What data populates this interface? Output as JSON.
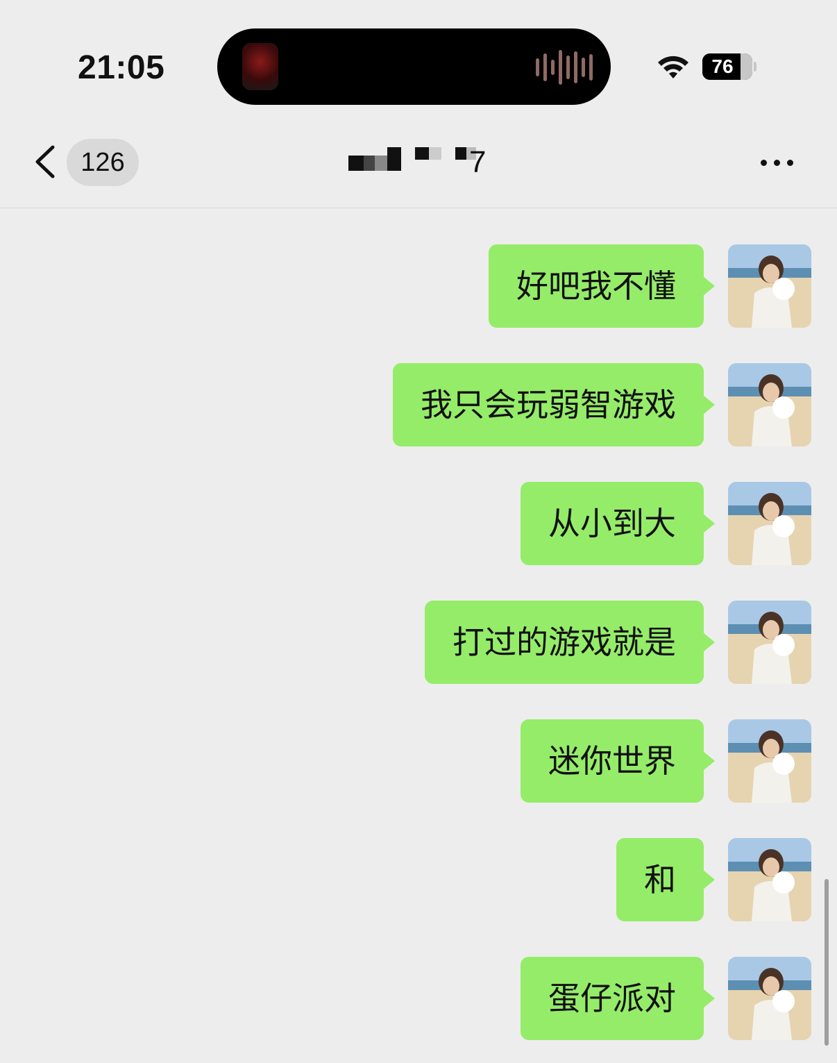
{
  "status_bar": {
    "time": "21:05",
    "battery_percent": 76,
    "battery_label": "76",
    "wifi_icon": "wifi-icon",
    "island_activity": "audio-recording"
  },
  "nav": {
    "back_icon": "chevron-left-icon",
    "unread_count": "126",
    "title_visible": "7",
    "title_pixelated": true,
    "more_icon": "more-dots-icon"
  },
  "messages": [
    {
      "sender": "me",
      "text": "好吧我不懂"
    },
    {
      "sender": "me",
      "text": "我只会玩弱智游戏"
    },
    {
      "sender": "me",
      "text": "从小到大"
    },
    {
      "sender": "me",
      "text": "打过的游戏就是"
    },
    {
      "sender": "me",
      "text": "迷你世界"
    },
    {
      "sender": "me",
      "text": "和"
    },
    {
      "sender": "me",
      "text": "蛋仔派对"
    }
  ],
  "colors": {
    "background": "#ededed",
    "bubble_sent": "#95ec69",
    "text": "#111111"
  }
}
